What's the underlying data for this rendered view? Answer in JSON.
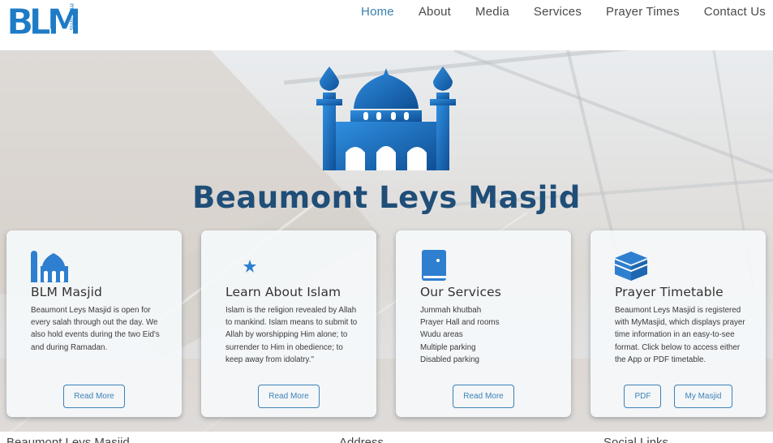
{
  "brand": {
    "logo_letters": "BLM",
    "logo_sub": "muslims",
    "color": "#1e7bc6"
  },
  "nav": {
    "items": [
      {
        "label": "Home",
        "active": true
      },
      {
        "label": "About"
      },
      {
        "label": "Media"
      },
      {
        "label": "Services"
      },
      {
        "label": "Prayer Times"
      },
      {
        "label": "Contact Us"
      }
    ]
  },
  "hero": {
    "title": "Beaumont Leys Masjid",
    "icon": "mosque-icon"
  },
  "cards": [
    {
      "icon": "mosque-small-icon",
      "title": "BLM Masjid",
      "text": "Beaumont Leys Masjid is open for every salah through out the day. We also hold events during the two Eid's and during Ramadan.",
      "buttons": [
        "Read More"
      ]
    },
    {
      "icon": "crescent-star-icon",
      "title": "Learn About Islam",
      "text": "Islam is the religion revealed by Allah to mankind. Islam means to submit to Allah by worshipping Him alone; to surrender to Him in obedience; to keep away from idolatry.\"",
      "buttons": [
        "Read More"
      ]
    },
    {
      "icon": "quran-icon",
      "title": "Our Services",
      "list": [
        "Jummah khutbah",
        "Prayer Hall and rooms",
        "Wudu areas",
        "Multiple parking",
        "Disabled parking"
      ],
      "buttons": [
        "Read More"
      ]
    },
    {
      "icon": "kaaba-icon",
      "title": "Prayer Timetable",
      "text": "Beaumont Leys Masjid is registered with MyMasjid, which displays prayer time information in an easy-to-see format. Click below to access either the App or PDF timetable.",
      "buttons": [
        "PDF",
        "My Masjid"
      ]
    }
  ],
  "footer": {
    "col1": "Beaumont Leys Masjid",
    "col2": "Address",
    "col3": "Social Links"
  }
}
